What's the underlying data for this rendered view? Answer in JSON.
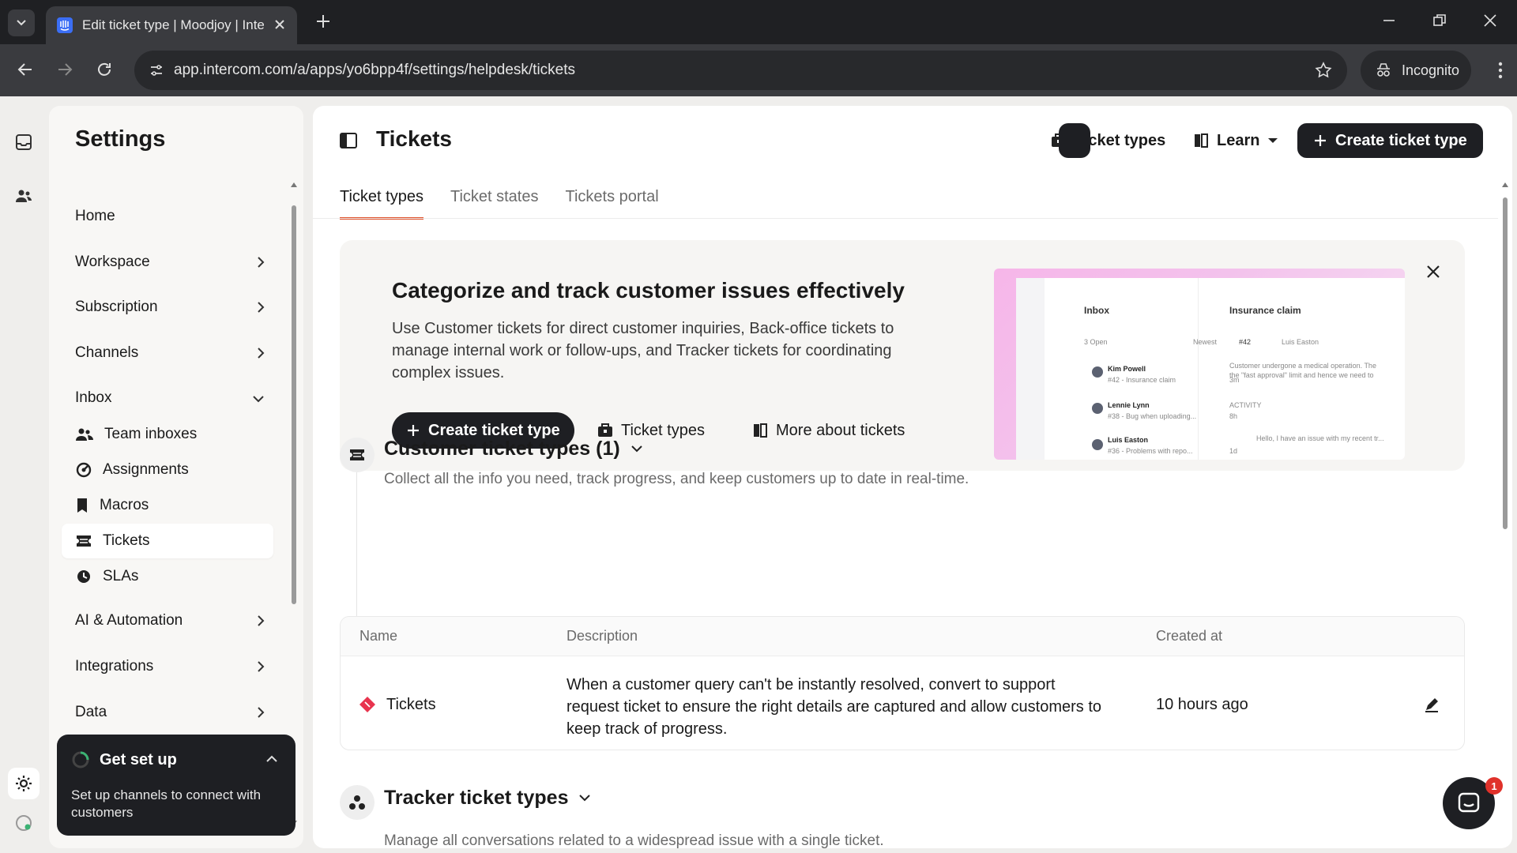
{
  "browser": {
    "tab_title": "Edit ticket type | Moodjoy | Inte",
    "url": "app.intercom.com/a/apps/yo6bpp4f/settings/helpdesk/tickets",
    "incognito_label": "Incognito"
  },
  "sidebar": {
    "title": "Settings",
    "items": [
      {
        "label": "Home",
        "icon": "none"
      },
      {
        "label": "Workspace",
        "icon": "chevron-right-icon"
      },
      {
        "label": "Subscription",
        "icon": "chevron-right-icon"
      },
      {
        "label": "Channels",
        "icon": "chevron-right-icon"
      },
      {
        "label": "Inbox",
        "icon": "chevron-down-icon"
      },
      {
        "label": "AI & Automation",
        "icon": "chevron-right-icon"
      },
      {
        "label": "Integrations",
        "icon": "chevron-right-icon"
      },
      {
        "label": "Data",
        "icon": "chevron-right-icon"
      }
    ],
    "inbox_subitems": [
      {
        "label": "Team inboxes",
        "icon": "people-icon"
      },
      {
        "label": "Assignments",
        "icon": "assignment-icon"
      },
      {
        "label": "Macros",
        "icon": "bookmark-icon"
      },
      {
        "label": "Tickets",
        "icon": "ticket-icon",
        "active": true
      },
      {
        "label": "SLAs",
        "icon": "clock-icon"
      }
    ],
    "setup": {
      "title": "Get set up",
      "text": "Set up channels to connect with customers"
    }
  },
  "header": {
    "title": "Tickets",
    "ticket_types_button": "Ticket types",
    "learn_button": "Learn",
    "create_button": "Create ticket type"
  },
  "tabs": [
    "Ticket types",
    "Ticket states",
    "Tickets portal"
  ],
  "banner": {
    "title": "Categorize and track customer issues effectively",
    "text": "Use Customer tickets for direct customer inquiries, Back-office tickets to manage internal work or follow-ups, and Tracker tickets for coordinating complex issues.",
    "create_button": "Create ticket type",
    "ticket_types_link": "Ticket types",
    "more_link": "More about tickets",
    "preview": {
      "inbox": "Inbox",
      "open": "3 Open",
      "newest": "Newest",
      "convo_title": "Insurance claim",
      "ticket_no": "#42",
      "assignee": "Luis Easton",
      "activity": "ACTIVITY",
      "rows": [
        {
          "name": "Kim Powell",
          "sub": "#42 - Insurance claim",
          "time": "3m"
        },
        {
          "name": "Lennie Lynn",
          "sub": "#38 - Bug when uploading...",
          "time": "8h"
        },
        {
          "name": "Luis Easton",
          "sub": "#36 - Problems with repo...",
          "time": "1d"
        }
      ],
      "msg1": "Customer undergone a medical operation. The",
      "msg2": "the \"fast approval\" limit and hence we need to",
      "msg3": "Hello, I have an issue with my recent tr..."
    }
  },
  "customer_section": {
    "title": "Customer ticket types (1)",
    "description": "Collect all the info you need, track progress, and keep customers up to date in real-time.",
    "columns": [
      "Name",
      "Description",
      "Created at"
    ],
    "rows": [
      {
        "name": "Tickets",
        "description": "When a customer query can't be instantly resolved, convert to support request ticket to ensure the right details are captured and allow customers to keep track of progress.",
        "created_at": "10 hours ago"
      }
    ]
  },
  "tracker_section": {
    "title": "Tracker ticket types",
    "description": "Manage all conversations related to a widespread issue with a single ticket."
  },
  "chat_badge": "1",
  "colors": {
    "accent_tab": "#e0512a",
    "dark_button": "#1e1f23",
    "ticket_icon": "#e8344e"
  }
}
